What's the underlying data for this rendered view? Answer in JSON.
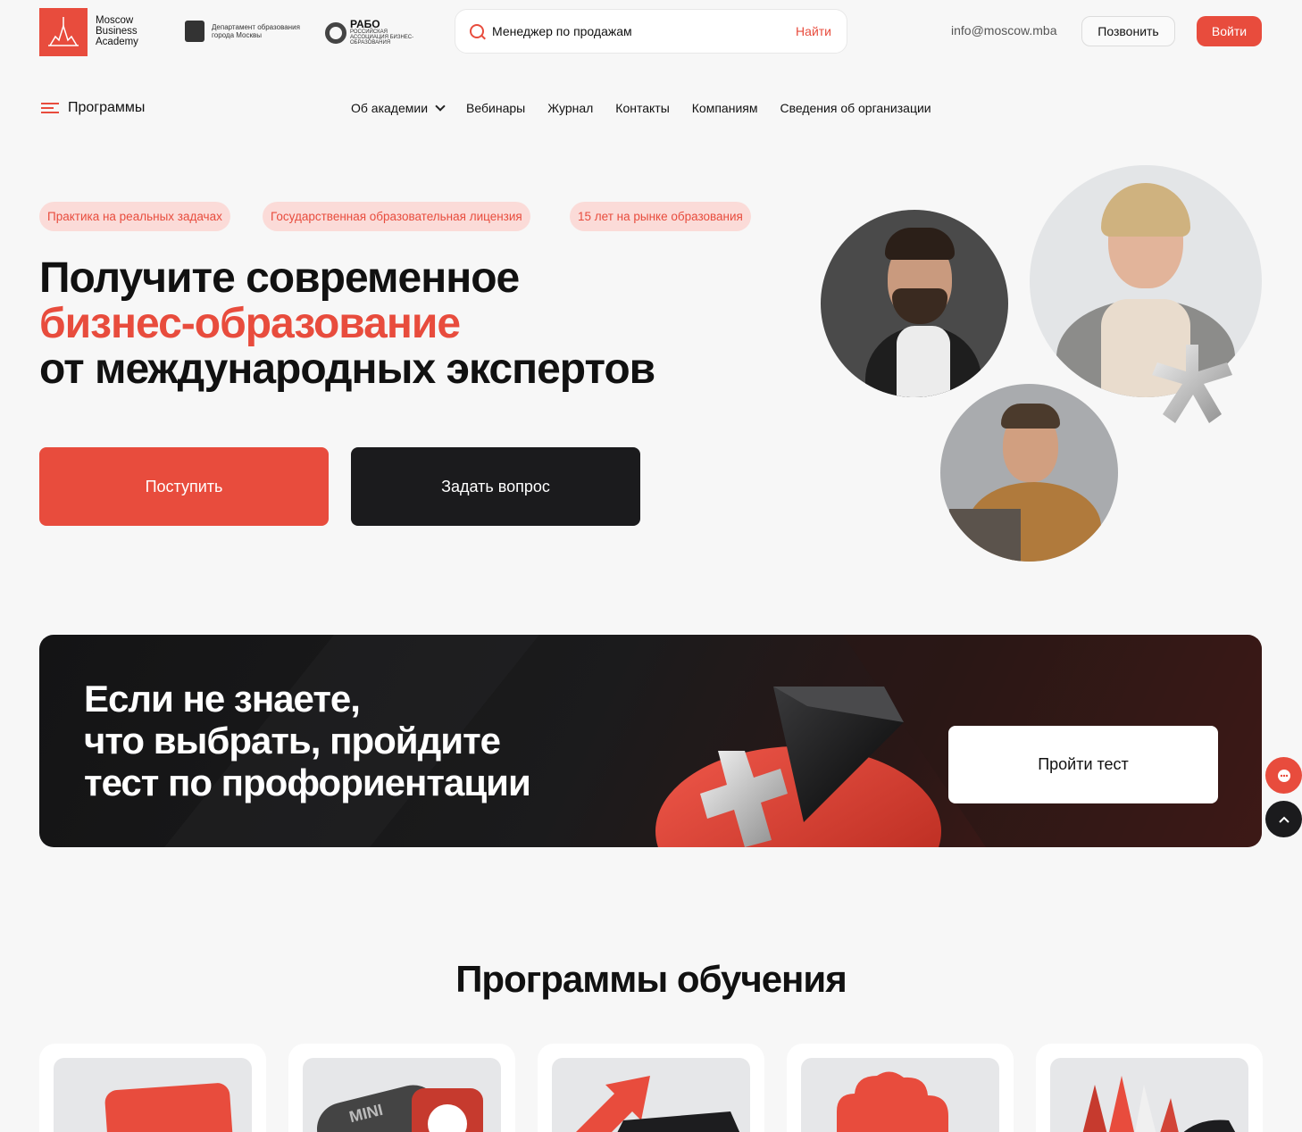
{
  "header": {
    "logo_lines": [
      "Moscow",
      "Business",
      "Academy"
    ],
    "dept_text": "Департамент образования города Москвы",
    "rabo_title": "РАБО",
    "rabo_sub": "РОССИЙСКАЯ АССОЦИАЦИЯ БИЗНЕС-ОБРАЗОВАНИЯ",
    "search_value": "Менеджер по продажам",
    "search_button": "Найти",
    "email": "info@moscow.mba",
    "call_label": "Позвонить",
    "login_label": "Войти"
  },
  "nav": {
    "programs_label": "Программы",
    "items": [
      "Об академии",
      "Вебинары",
      "Журнал",
      "Контакты",
      "Компаниям",
      "Сведения об организации"
    ]
  },
  "hero": {
    "badges": [
      "Практика на реальных задачах",
      "Государственная образовательная лицензия",
      "15 лет на рынке образования"
    ],
    "title_line1": "Получите современное",
    "title_line2": "бизнес-образование",
    "title_line3": "от международных экспертов",
    "apply_label": "Поступить",
    "ask_label": "Задать вопрос"
  },
  "banner": {
    "line1": "Если не знаете,",
    "line2": "что выбрать, пройдите",
    "line3": "тест по профориентации",
    "button": "Пройти тест"
  },
  "programs": {
    "title": "Программы обучения",
    "card_mini_text": "MINI"
  },
  "colors": {
    "accent": "#e84c3d",
    "dark": "#1b1b1d",
    "badge_bg": "#fbdbd8",
    "page_bg": "#f7f7f7"
  }
}
